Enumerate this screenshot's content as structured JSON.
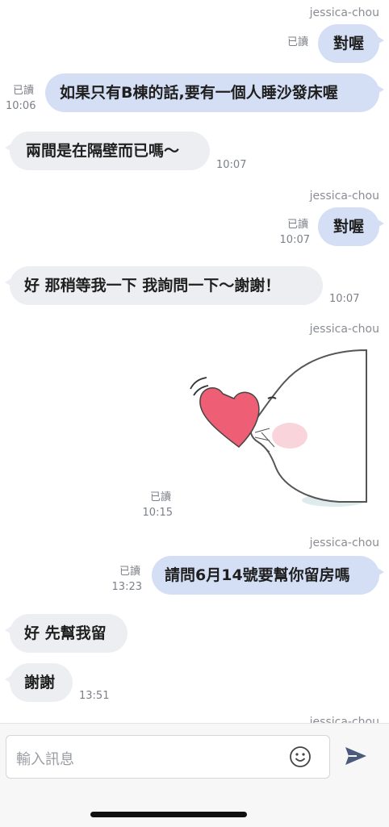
{
  "partial_sender": "jessica-chou",
  "messages": [
    {
      "sender": "jessica-chou",
      "text": "對喔",
      "read": "已讀",
      "time": ""
    },
    {
      "text": "如果只有B棟的話,要有一個人睡沙發床喔",
      "read": "已讀",
      "time": "10:06"
    },
    {
      "text": "兩間是在隔壁而已嗎～",
      "time": "10:07"
    },
    {
      "sender": "jessica-chou",
      "text": "對喔",
      "read": "已讀",
      "time": "10:07"
    },
    {
      "text": "好 那稍等我一下 我詢問一下～謝謝！",
      "time": "10:07"
    },
    {
      "sender": "jessica-chou",
      "sticker": "seal-with-heart-sticker",
      "read": "已讀",
      "time": "10:15"
    },
    {
      "sender": "jessica-chou",
      "text": "請問6月14號要幫你留房嗎",
      "read": "已讀",
      "time": "13:23"
    },
    {
      "text": "好 先幫我留",
      "time": ""
    },
    {
      "text": "謝謝",
      "time": "13:51"
    }
  ],
  "input": {
    "placeholder": "輸入訊息",
    "emoji_icon": "emoji-icon",
    "send_icon": "send-icon"
  },
  "colors": {
    "outgoing": "#d4dff5",
    "incoming": "#eceef1",
    "meta": "#7c8088",
    "send": "#4a5a7a"
  }
}
